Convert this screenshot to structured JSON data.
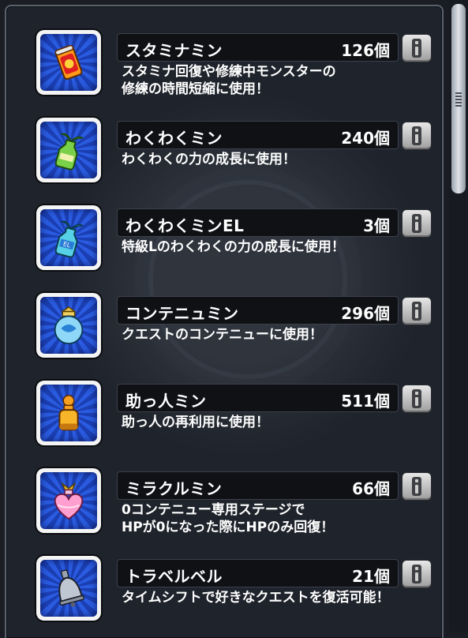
{
  "items": [
    {
      "name": "スタミナミン",
      "count": "126個",
      "desc": "スタミナ回復や修練中モンスターの\n修練の時間短縮に使用！",
      "icon": "stamina-can-icon"
    },
    {
      "name": "わくわくミン",
      "count": "240個",
      "desc": "わくわくの力の成長に使用！",
      "icon": "green-bottle-icon"
    },
    {
      "name": "わくわくミンEL",
      "count": "3個",
      "desc": "特級Lのわくわくの力の成長に使用！",
      "icon": "el-bottle-icon"
    },
    {
      "name": "コンテニュミン",
      "count": "296個",
      "desc": "クエストのコンテニューに使用！",
      "icon": "blue-jar-icon"
    },
    {
      "name": "助っ人ミン",
      "count": "511個",
      "desc": "助っ人の再利用に使用！",
      "icon": "orange-bottle-icon"
    },
    {
      "name": "ミラクルミン",
      "count": "66個",
      "desc": "0コンテニュー専用ステージで\nHPが0になった際にHPのみ回復！",
      "icon": "pink-heart-bottle-icon"
    },
    {
      "name": "トラベルベル",
      "count": "21個",
      "desc": "タイムシフトで好きなクエストを復活可能！",
      "icon": "bell-icon"
    }
  ]
}
